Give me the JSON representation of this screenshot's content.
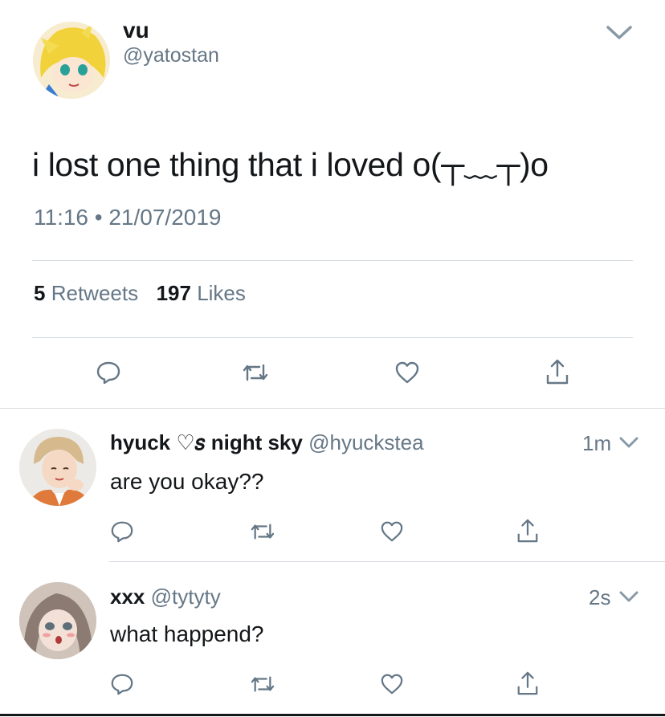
{
  "tweet": {
    "display_name": "vu",
    "handle": "@yatostan",
    "text": "i lost one thing that i loved o(┬﹏┬)o",
    "timestamp": "11:16 • 21/07/2019",
    "retweets_count": "5",
    "retweets_label": "Retweets",
    "likes_count": "197",
    "likes_label": "Likes"
  },
  "replies": [
    {
      "display_name": "hyuck ♡𝑠 night sky",
      "handle": "@hyuckstea",
      "time": "1m",
      "text": "are you okay??"
    },
    {
      "display_name": "xxx",
      "handle": "@tytyty",
      "time": "2s",
      "text": "what happend?"
    }
  ],
  "icons": {
    "reply": "reply-icon",
    "retweet": "retweet-icon",
    "like": "heart-icon",
    "share": "share-icon",
    "menu": "chevron-down-icon"
  },
  "colors": {
    "text": "#14171a",
    "muted": "#657786",
    "divider": "#d6dbe0",
    "icon": "#657786"
  }
}
